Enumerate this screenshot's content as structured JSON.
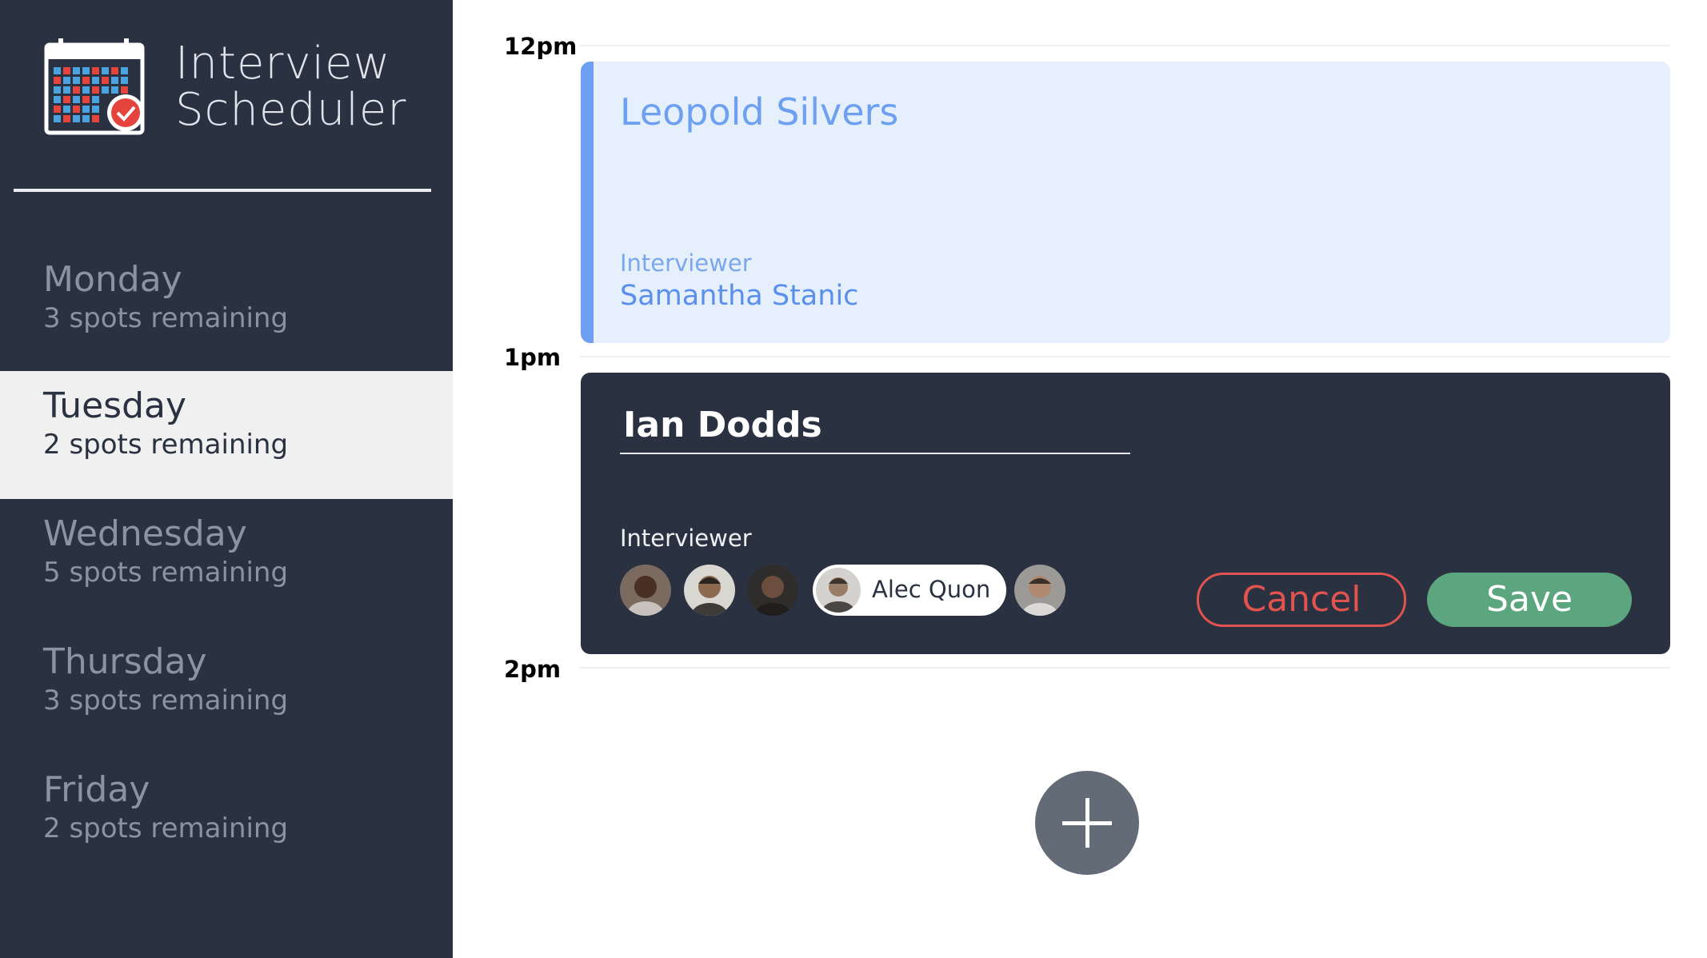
{
  "app": {
    "title_line1": "Interview",
    "title_line2": "Scheduler"
  },
  "colors": {
    "sidebar_bg": "#2a3140",
    "selected_bg": "#f0f0f0",
    "booked_bg": "#e6effc",
    "booked_accent": "#6e9ff3",
    "cancel_color": "#e0534f",
    "save_color": "#5ca67f",
    "add_button": "#636b77"
  },
  "sidebar": {
    "days": [
      {
        "name": "Monday",
        "spots": "3 spots remaining",
        "selected": false
      },
      {
        "name": "Tuesday",
        "spots": "2 spots remaining",
        "selected": true
      },
      {
        "name": "Wednesday",
        "spots": "5 spots remaining",
        "selected": false
      },
      {
        "name": "Thursday",
        "spots": "3 spots remaining",
        "selected": false
      },
      {
        "name": "Friday",
        "spots": "2 spots remaining",
        "selected": false
      }
    ]
  },
  "schedule": {
    "times": [
      "12pm",
      "1pm",
      "2pm"
    ],
    "booked": {
      "student": "Leopold Silvers",
      "interviewer_label": "Interviewer",
      "interviewer_name": "Samantha Stanic"
    },
    "form": {
      "student_value": "Ian Dodds",
      "interviewer_label": "Interviewer",
      "interviewers": [
        {
          "icon": "avatar-1"
        },
        {
          "icon": "avatar-2"
        },
        {
          "icon": "avatar-3"
        },
        {
          "name": "Alec Quon",
          "icon": "avatar-4",
          "selected": true
        },
        {
          "icon": "avatar-5"
        }
      ],
      "cancel_label": "Cancel",
      "save_label": "Save"
    },
    "add_icon": "plus-icon"
  }
}
